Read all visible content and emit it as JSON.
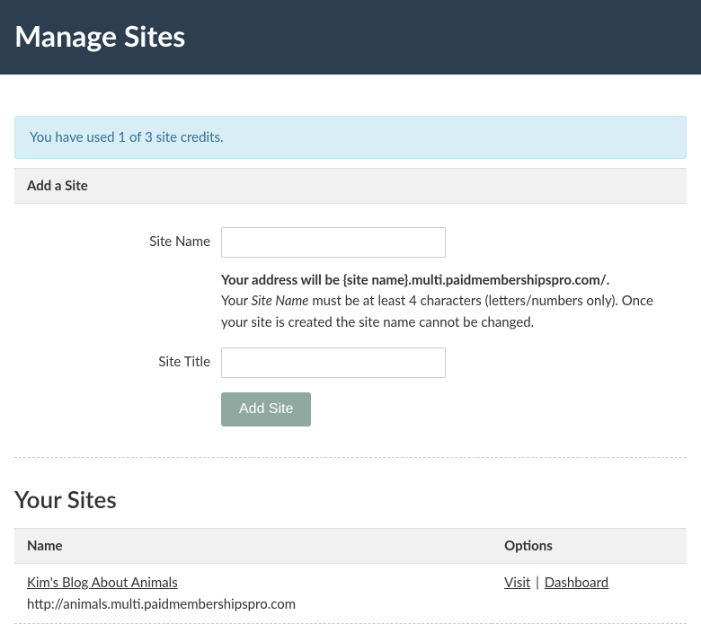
{
  "header": {
    "title": "Manage Sites"
  },
  "notice": {
    "text": "You have used 1 of 3 site credits."
  },
  "add_site": {
    "section_title": "Add a Site",
    "site_name_label": "Site Name",
    "site_name_value": "",
    "help_bold": "Your address will be {site name}.multi.paidmembershipspro.com/.",
    "help_line2a": "Your ",
    "help_line2_em": "Site Name",
    "help_line2b": " must be at least 4 characters (letters/numbers only). Once your site is created the site name cannot be changed.",
    "site_title_label": "Site Title",
    "site_title_value": "",
    "submit_label": "Add Site"
  },
  "your_sites": {
    "heading": "Your Sites",
    "col_name": "Name",
    "col_options": "Options",
    "rows": [
      {
        "name": "Kim's Blog About Animals",
        "url": "http://animals.multi.paidmembershipspro.com",
        "visit_label": "Visit",
        "dashboard_label": "Dashboard"
      }
    ],
    "separator": " | "
  }
}
